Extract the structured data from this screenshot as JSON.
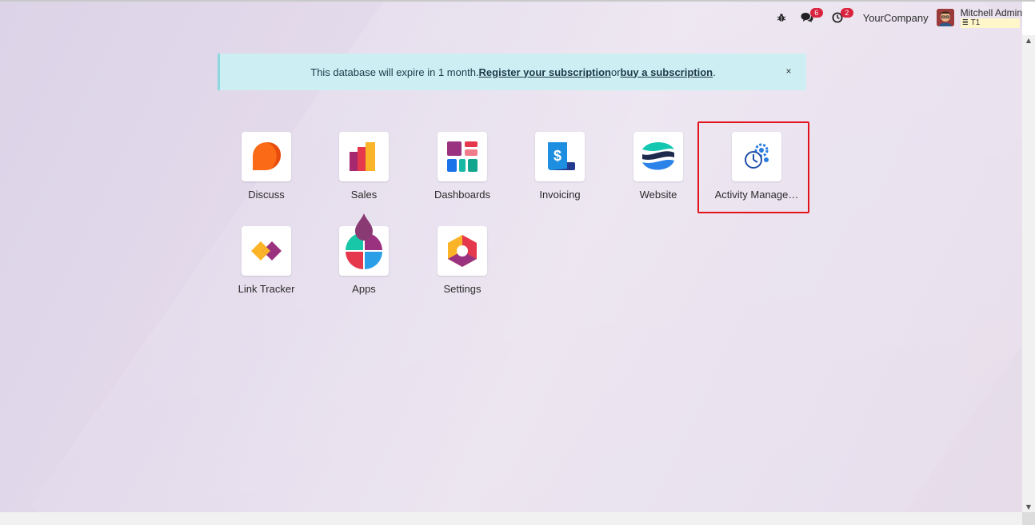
{
  "systray": {
    "debug_icon": "bug-icon",
    "messages": {
      "icon": "chat-icon",
      "count": "6"
    },
    "activities": {
      "icon": "clock-icon",
      "count": "2"
    },
    "company": "YourCompany",
    "user": {
      "name": "Mitchell Admin",
      "db": "T1"
    }
  },
  "banner": {
    "text_before": "This database will expire in 1 month. ",
    "link1": "Register your subscription",
    "text_mid": " or ",
    "link2": "buy a subscription",
    "text_after": ".",
    "close": "×"
  },
  "apps": [
    {
      "label": "Discuss"
    },
    {
      "label": "Sales"
    },
    {
      "label": "Dashboards"
    },
    {
      "label": "Invoicing"
    },
    {
      "label": "Website"
    },
    {
      "label": "Activity Manage…"
    },
    {
      "label": "Link Tracker"
    },
    {
      "label": "Apps"
    },
    {
      "label": "Settings"
    }
  ],
  "colors": {
    "highlight": "#e3131b",
    "banner_bg": "#cdeef2",
    "badge": "#d9233f"
  }
}
